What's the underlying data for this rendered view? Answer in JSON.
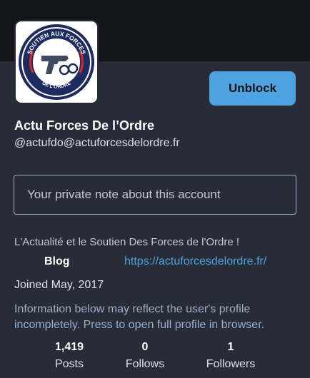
{
  "profile": {
    "display_name": "Actu Forces De l’Ordre",
    "handle": "@actufdo@actuforcesdelordre.fr",
    "avatar": {
      "icon": "police-logo-icon",
      "text_top": "SOUTIEN AUX FORCES",
      "text_bottom": "DE L'ORDRE"
    }
  },
  "actions": {
    "unblock_label": "Unblock"
  },
  "note": {
    "placeholder": "Your private note about this account",
    "value": ""
  },
  "bio": "L'Actualité et le Soutien Des Forces de l'Ordre !",
  "fields": [
    {
      "name": "Blog",
      "value": "https://actuforcesdelordre.fr/"
    }
  ],
  "joined": "Joined May, 2017",
  "info_note": "Information below may reflect the user's profile incompletely. Press to open full profile in browser.",
  "stats": [
    {
      "value": "1,419",
      "label": "Posts"
    },
    {
      "value": "0",
      "label": "Follows"
    },
    {
      "value": "1",
      "label": "Followers"
    }
  ],
  "colors": {
    "background": "#282c37",
    "banner": "#13151b",
    "accent": "#4ea2e0",
    "logo_navy": "#1d2b5e",
    "logo_red": "#d7262e"
  }
}
